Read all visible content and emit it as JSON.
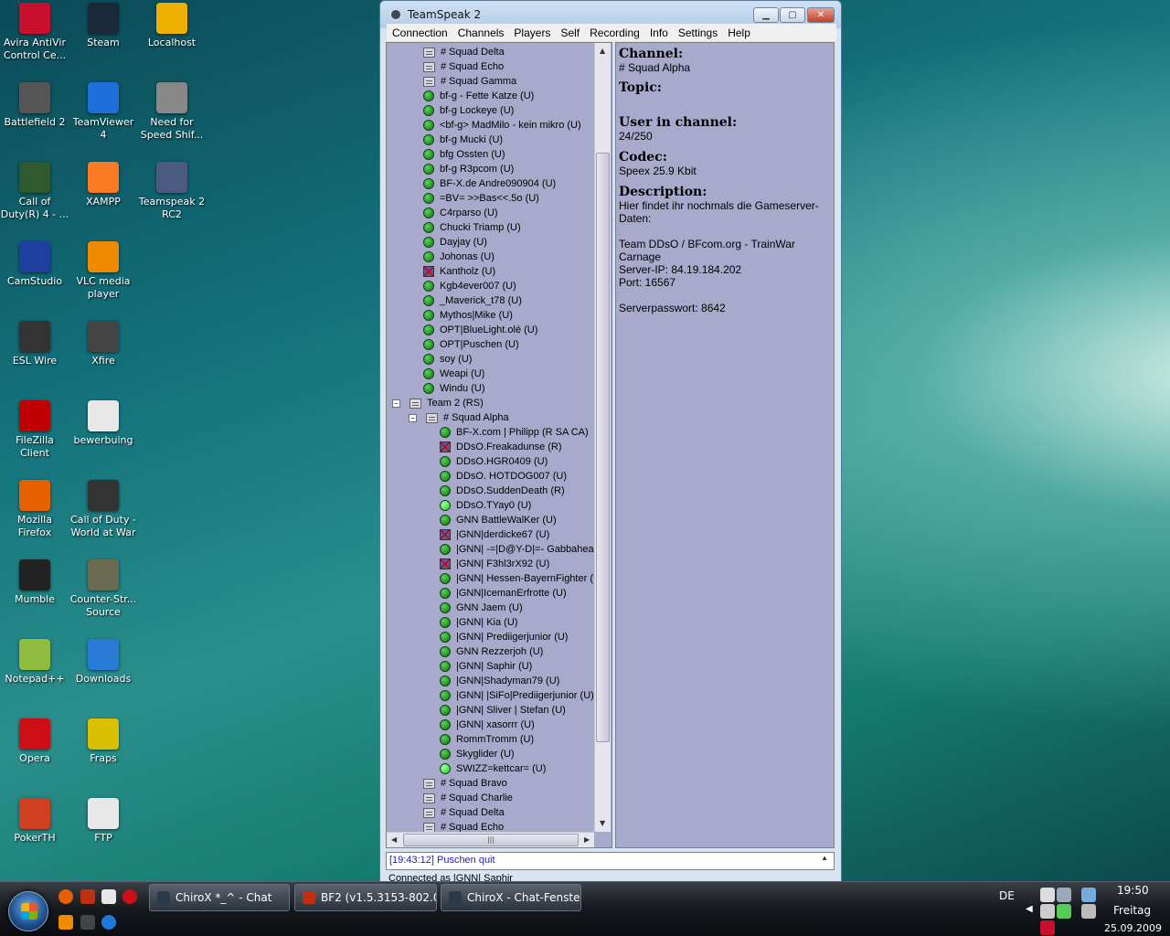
{
  "desktop_icons": [
    {
      "label": "Avira AntiVir Control Ce...",
      "icon": "avira-icon",
      "color": "#c8102e",
      "col": 0,
      "row": 0
    },
    {
      "label": "Steam",
      "icon": "steam-icon",
      "color": "#1b2838",
      "col": 1,
      "row": 0
    },
    {
      "label": "Localhost",
      "icon": "localhost-icon",
      "color": "#f0b000",
      "col": 2,
      "row": 0
    },
    {
      "label": "Battlefield 2",
      "icon": "battlefield-icon",
      "color": "#555555",
      "col": 0,
      "row": 1
    },
    {
      "label": "TeamViewer 4",
      "icon": "teamviewer-icon",
      "color": "#1e6fd9",
      "col": 1,
      "row": 1
    },
    {
      "label": "Need for Speed Shif...",
      "icon": "nfs-icon",
      "color": "#888888",
      "col": 2,
      "row": 1
    },
    {
      "label": "Call of Duty(R) 4 - ...",
      "icon": "cod4-icon",
      "color": "#2f5a2f",
      "col": 0,
      "row": 2
    },
    {
      "label": "XAMPP",
      "icon": "xampp-icon",
      "color": "#fb7a24",
      "col": 1,
      "row": 2
    },
    {
      "label": "Teamspeak 2 RC2",
      "icon": "teamspeak-icon",
      "color": "#4a5a80",
      "col": 2,
      "row": 2
    },
    {
      "label": "CamStudio",
      "icon": "camstudio-icon",
      "color": "#1f3fa0",
      "col": 0,
      "row": 3
    },
    {
      "label": "VLC media player",
      "icon": "vlc-icon",
      "color": "#f08a00",
      "col": 1,
      "row": 3
    },
    {
      "label": "ESL Wire",
      "icon": "eslwire-icon",
      "color": "#333333",
      "col": 0,
      "row": 4
    },
    {
      "label": "Xfire",
      "icon": "xfire-icon",
      "color": "#444444",
      "col": 1,
      "row": 4
    },
    {
      "label": "FileZilla Client",
      "icon": "filezilla-icon",
      "color": "#bf0000",
      "col": 0,
      "row": 5
    },
    {
      "label": "bewerbuing",
      "icon": "document-icon",
      "color": "#e8e8e8",
      "col": 1,
      "row": 5
    },
    {
      "label": "Mozilla Firefox",
      "icon": "firefox-icon",
      "color": "#e66000",
      "col": 0,
      "row": 6
    },
    {
      "label": "Call of Duty - World at War",
      "icon": "codwaw-icon",
      "color": "#333333",
      "col": 1,
      "row": 6
    },
    {
      "label": "Mumble",
      "icon": "mumble-icon",
      "color": "#222222",
      "col": 0,
      "row": 7
    },
    {
      "label": "Counter-Str... Source",
      "icon": "css-icon",
      "color": "#6a6a50",
      "col": 1,
      "row": 7
    },
    {
      "label": "Notepad++",
      "icon": "notepadpp-icon",
      "color": "#8fbc3f",
      "col": 0,
      "row": 8
    },
    {
      "label": "Downloads",
      "icon": "downloads-icon",
      "color": "#2a7ad8",
      "col": 1,
      "row": 8
    },
    {
      "label": "Opera",
      "icon": "opera-icon",
      "color": "#cc0f16",
      "col": 0,
      "row": 9
    },
    {
      "label": "Fraps",
      "icon": "fraps-icon",
      "color": "#d8c000",
      "col": 1,
      "row": 9
    },
    {
      "label": "PokerTH",
      "icon": "pokerth-icon",
      "color": "#d04020",
      "col": 0,
      "row": 10
    },
    {
      "label": "FTP",
      "icon": "document-icon",
      "color": "#e8e8e8",
      "col": 1,
      "row": 10
    }
  ],
  "window": {
    "title": "TeamSpeak 2",
    "menu": [
      "Connection",
      "Channels",
      "Players",
      "Self",
      "Recording",
      "Info",
      "Settings",
      "Help"
    ]
  },
  "tree": [
    {
      "type": "channel",
      "indent": 1,
      "text": "# Squad Delta"
    },
    {
      "type": "channel",
      "indent": 1,
      "text": "# Squad Echo"
    },
    {
      "type": "channel",
      "indent": 1,
      "text": "# Squad Gamma"
    },
    {
      "type": "player",
      "indent": 1,
      "text": "bf-g - Fette Katze  (U)"
    },
    {
      "type": "player",
      "indent": 1,
      "text": "bf-g Lockeye  (U)"
    },
    {
      "type": "player",
      "indent": 1,
      "text": "<bf-g> MadMilo - kein mikro  (U)"
    },
    {
      "type": "player",
      "indent": 1,
      "text": "bf-g Mucki  (U)"
    },
    {
      "type": "player",
      "indent": 1,
      "text": "bfg Ossten  (U)"
    },
    {
      "type": "player",
      "indent": 1,
      "text": "bf-g R3pcom  (U)"
    },
    {
      "type": "player",
      "indent": 1,
      "text": "BF-X.de Andre090904  (U)"
    },
    {
      "type": "player",
      "indent": 1,
      "text": "=BV= >>Bas<<.5o  (U)"
    },
    {
      "type": "player",
      "indent": 1,
      "text": "C4rparso  (U)"
    },
    {
      "type": "player",
      "indent": 1,
      "text": "Chucki Triamp  (U)"
    },
    {
      "type": "player",
      "indent": 1,
      "text": "Dayjay  (U)"
    },
    {
      "type": "player",
      "indent": 1,
      "text": "Johonas  (U)"
    },
    {
      "type": "player",
      "indent": 1,
      "text": "Kantholz  (U)",
      "status": "mute"
    },
    {
      "type": "player",
      "indent": 1,
      "text": "Kgb4ever007  (U)"
    },
    {
      "type": "player",
      "indent": 1,
      "text": "_Maverick_t78  (U)"
    },
    {
      "type": "player",
      "indent": 1,
      "text": "Mythos|Mike  (U)"
    },
    {
      "type": "player",
      "indent": 1,
      "text": "OPT|BlueLight.olé  (U)"
    },
    {
      "type": "player",
      "indent": 1,
      "text": "OPT|Puschen  (U)"
    },
    {
      "type": "player",
      "indent": 1,
      "text": "soy  (U)"
    },
    {
      "type": "player",
      "indent": 1,
      "text": "Weapi  (U)"
    },
    {
      "type": "player",
      "indent": 1,
      "text": "Windu  (U)"
    },
    {
      "type": "team",
      "indent": 0,
      "text": "Team 2   (RS)"
    },
    {
      "type": "subchannel",
      "indent": 1,
      "text": "# Squad Alpha"
    },
    {
      "type": "player",
      "indent": 2,
      "text": "BF-X.com | Philipp  (R SA CA)"
    },
    {
      "type": "player",
      "indent": 2,
      "text": "DDsO.Freakadunse  (R)",
      "status": "mute"
    },
    {
      "type": "player",
      "indent": 2,
      "text": "DDsO.HGR0409  (U)"
    },
    {
      "type": "player",
      "indent": 2,
      "text": "DDsO. HOTDOG007  (U)"
    },
    {
      "type": "player",
      "indent": 2,
      "text": "DDsO.SuddenDeath  (R)"
    },
    {
      "type": "player",
      "indent": 2,
      "text": "DDsO.TYay0  (U)",
      "status": "lit"
    },
    {
      "type": "player",
      "indent": 2,
      "text": "GNN BattleWalKer  (U)"
    },
    {
      "type": "player",
      "indent": 2,
      "text": "|GNN|derdicke67  (U)",
      "status": "mute"
    },
    {
      "type": "player",
      "indent": 2,
      "text": "|GNN| -=|D@Y-D|=- Gabbahead"
    },
    {
      "type": "player",
      "indent": 2,
      "text": "|GNN| F3hl3rX92  (U)",
      "status": "mute"
    },
    {
      "type": "player",
      "indent": 2,
      "text": "|GNN| Hessen-BayernFighter  (U)"
    },
    {
      "type": "player",
      "indent": 2,
      "text": "|GNN|IcemanErfrotte  (U)"
    },
    {
      "type": "player",
      "indent": 2,
      "text": "GNN  Jaem  (U)"
    },
    {
      "type": "player",
      "indent": 2,
      "text": "|GNN| Kia  (U)"
    },
    {
      "type": "player",
      "indent": 2,
      "text": "|GNN| Prediigerjunior  (U)"
    },
    {
      "type": "player",
      "indent": 2,
      "text": "GNN Rezzerjoh  (U)"
    },
    {
      "type": "player",
      "indent": 2,
      "text": "|GNN| Saphir  (U)"
    },
    {
      "type": "player",
      "indent": 2,
      "text": "|GNN|Shadyman79  (U)"
    },
    {
      "type": "player",
      "indent": 2,
      "text": "|GNN| |SiFo|Prediigerjunior  (U)"
    },
    {
      "type": "player",
      "indent": 2,
      "text": "|GNN| Sliver  | Stefan  (U)"
    },
    {
      "type": "player",
      "indent": 2,
      "text": "|GNN| xasorrr  (U)"
    },
    {
      "type": "player",
      "indent": 2,
      "text": "RommTromm  (U)"
    },
    {
      "type": "player",
      "indent": 2,
      "text": "Skyglider  (U)"
    },
    {
      "type": "player",
      "indent": 2,
      "text": "SWIZZ=kettcar=  (U)",
      "status": "lit"
    },
    {
      "type": "channel",
      "indent": 1,
      "text": "# Squad Bravo"
    },
    {
      "type": "channel",
      "indent": 1,
      "text": "# Squad Charlie"
    },
    {
      "type": "channel",
      "indent": 1,
      "text": "# Squad Delta"
    },
    {
      "type": "channel",
      "indent": 1,
      "text": "# Squad Echo"
    }
  ],
  "info": {
    "channel_label": "Channel:",
    "channel_value": "# Squad Alpha",
    "topic_label": "Topic:",
    "users_label": "User in channel:",
    "users_value": "24/250",
    "codec_label": "Codec:",
    "codec_value": "Speex 25.9 Kbit",
    "desc_label": "Description:",
    "desc_lines": [
      "Hier findet ihr nochmals die Gameserver-",
      "Daten:",
      "",
      "Team DDsO / BFcom.org - TrainWar",
      "Carnage",
      "Server-IP: 84.19.184.202",
      "Port: 16567",
      "",
      "Serverpasswort: 8642"
    ]
  },
  "log_line": "[19:43:12] Puschen quit",
  "status_text": "Connected as |GNN| Saphir",
  "taskbar": {
    "tasks": [
      {
        "label": "ChiroX *_^ - Chat",
        "icon": "steam-chat-icon",
        "color": "#2a3a4a"
      },
      {
        "label": "BF2 (v1.5.3153-802.0...",
        "icon": "bf2-icon",
        "color": "#c03010"
      },
      {
        "label": "ChiroX - Chat-Fenster",
        "icon": "steam-chat-icon",
        "color": "#2a3a4a"
      }
    ],
    "lang": "DE",
    "time": "19:50",
    "day": "Freitag",
    "date": "25.09.2009"
  }
}
